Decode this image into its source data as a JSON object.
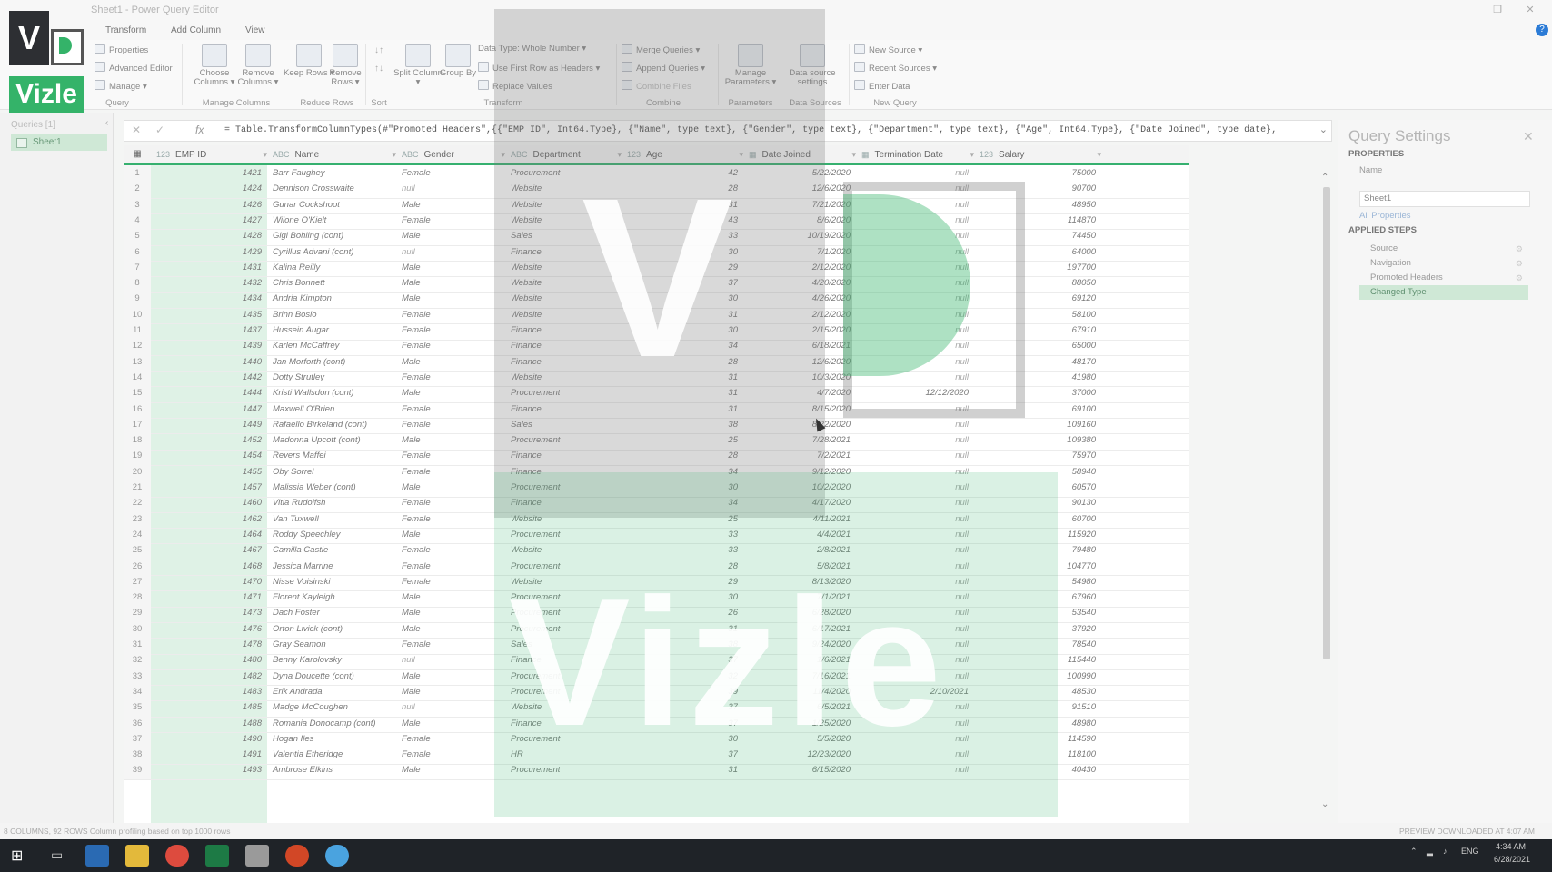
{
  "window": {
    "title": "Sheet1 - Power Query Editor"
  },
  "ribbon_tabs": [
    "Transform",
    "Add Column",
    "View"
  ],
  "ribbon": {
    "properties": "Properties",
    "advanced_editor": "Advanced Editor",
    "manage": "Manage ▾",
    "choose_columns": "Choose Columns ▾",
    "remove_columns": "Remove Columns ▾",
    "keep_rows": "Keep Rows ▾",
    "remove_rows": "Remove Rows ▾",
    "split_column": "Split Column ▾",
    "group_by": "Group By",
    "data_type": "Data Type: Whole Number ▾",
    "first_row_headers": "Use First Row as Headers ▾",
    "replace_values": "Replace Values",
    "merge_queries": "Merge Queries ▾",
    "append_queries": "Append Queries ▾",
    "combine_files": "Combine Files",
    "manage_parameters": "Manage Parameters ▾",
    "data_source_settings": "Data source settings",
    "new_source": "New Source ▾",
    "recent_sources": "Recent Sources ▾",
    "enter_data": "Enter Data",
    "groups": [
      "Query",
      "Manage Columns",
      "Reduce Rows",
      "Sort",
      "Transform",
      "Combine",
      "Parameters",
      "Data Sources",
      "New Query"
    ]
  },
  "left_panel": {
    "title": "Queries [1]",
    "item": "Sheet1"
  },
  "formula": "= Table.TransformColumnTypes(#\"Promoted Headers\",{{\"EMP ID\", Int64.Type}, {\"Name\", type text}, {\"Gender\", type text}, {\"Department\", type text}, {\"Age\", Int64.Type}, {\"Date Joined\", type date},",
  "columns": [
    "EMP ID",
    "Name",
    "Gender",
    "Department",
    "Age",
    "Date Joined",
    "Termination Date",
    "Salary"
  ],
  "column_type_icons": [
    "123",
    "ABC",
    "ABC",
    "ABC",
    "123",
    "▦",
    "▦",
    "123"
  ],
  "rows": [
    [
      "1421",
      "Barr Faughey",
      "Female",
      "Procurement",
      "42",
      "5/22/2020",
      "null",
      "75000"
    ],
    [
      "1424",
      "Dennison Crosswaite",
      "null",
      "Website",
      "28",
      "12/6/2020",
      "null",
      "90700"
    ],
    [
      "1426",
      "Gunar Cockshoot",
      "Male",
      "Website",
      "31",
      "7/21/2020",
      "null",
      "48950"
    ],
    [
      "1427",
      "Wilone O'Kielt",
      "Female",
      "Website",
      "43",
      "8/6/2020",
      "null",
      "114870"
    ],
    [
      "1428",
      "Gigi Bohling (cont)",
      "Male",
      "Sales",
      "33",
      "10/19/2020",
      "null",
      "74450"
    ],
    [
      "1429",
      "Cyrillus Advani (cont)",
      "null",
      "Finance",
      "30",
      "7/1/2020",
      "null",
      "64000"
    ],
    [
      "1431",
      "Kalina Reilly",
      "Male",
      "Website",
      "29",
      "2/12/2020",
      "null",
      "197700"
    ],
    [
      "1432",
      "Chris Bonnett",
      "Male",
      "Website",
      "37",
      "4/20/2020",
      "null",
      "88050"
    ],
    [
      "1434",
      "Andria Kimpton",
      "Male",
      "Website",
      "30",
      "4/26/2020",
      "null",
      "69120"
    ],
    [
      "1435",
      "Brinn Bosio",
      "Female",
      "Website",
      "31",
      "2/12/2020",
      "null",
      "58100"
    ],
    [
      "1437",
      "Hussein Augar",
      "Female",
      "Finance",
      "30",
      "2/15/2020",
      "null",
      "67910"
    ],
    [
      "1439",
      "Karlen McCaffrey",
      "Female",
      "Finance",
      "34",
      "6/18/2021",
      "null",
      "65000"
    ],
    [
      "1440",
      "Jan Morforth (cont)",
      "Male",
      "Finance",
      "28",
      "12/6/2020",
      "null",
      "48170"
    ],
    [
      "1442",
      "Dotty Strutley",
      "Female",
      "Website",
      "31",
      "10/3/2020",
      "null",
      "41980"
    ],
    [
      "1444",
      "Kristi Wallsdon (cont)",
      "Male",
      "Procurement",
      "31",
      "4/7/2020",
      "12/12/2020",
      "37000"
    ],
    [
      "1447",
      "Maxwell O'Brien",
      "Female",
      "Finance",
      "31",
      "8/15/2020",
      "null",
      "69100"
    ],
    [
      "1449",
      "Rafaello Birkeland (cont)",
      "Female",
      "Sales",
      "38",
      "8/22/2020",
      "null",
      "109160"
    ],
    [
      "1452",
      "Madonna Upcott (cont)",
      "Male",
      "Procurement",
      "25",
      "7/28/2021",
      "null",
      "109380"
    ],
    [
      "1454",
      "Revers Maffei",
      "Female",
      "Finance",
      "28",
      "7/2/2021",
      "null",
      "75970"
    ],
    [
      "1455",
      "Oby Sorrel",
      "Female",
      "Finance",
      "34",
      "9/12/2020",
      "null",
      "58940"
    ],
    [
      "1457",
      "Malissia Weber (cont)",
      "Male",
      "Procurement",
      "30",
      "10/2/2020",
      "null",
      "60570"
    ],
    [
      "1460",
      "Vitia Rudolfsh",
      "Female",
      "Finance",
      "34",
      "4/17/2020",
      "null",
      "90130"
    ],
    [
      "1462",
      "Van Tuxwell",
      "Female",
      "Website",
      "25",
      "4/11/2021",
      "null",
      "60700"
    ],
    [
      "1464",
      "Roddy Speechley",
      "Male",
      "Procurement",
      "33",
      "4/4/2021",
      "null",
      "115920"
    ],
    [
      "1467",
      "Camilla Castle",
      "Female",
      "Website",
      "33",
      "2/8/2021",
      "null",
      "79480"
    ],
    [
      "1468",
      "Jessica Marrine",
      "Female",
      "Procurement",
      "28",
      "5/8/2021",
      "null",
      "104770"
    ],
    [
      "1470",
      "Nisse Voisinski",
      "Female",
      "Website",
      "29",
      "8/13/2020",
      "null",
      "54980"
    ],
    [
      "1471",
      "Florent Kayleigh",
      "Male",
      "Procurement",
      "30",
      "7/1/2021",
      "null",
      "67960"
    ],
    [
      "1473",
      "Dach Foster",
      "Male",
      "Procurement",
      "26",
      "6/28/2020",
      "null",
      "53540"
    ],
    [
      "1476",
      "Orton Livick (cont)",
      "Male",
      "Procurement",
      "31",
      "6/17/2021",
      "null",
      "37920"
    ],
    [
      "1478",
      "Gray Seamon",
      "Female",
      "Sales",
      "38",
      "9/24/2020",
      "null",
      "78540"
    ],
    [
      "1480",
      "Benny Karolovsky",
      "null",
      "Finance",
      "37",
      "1/6/2021",
      "null",
      "115440"
    ],
    [
      "1482",
      "Dyna Doucette (cont)",
      "Male",
      "Procurement",
      "32",
      "7/16/2021",
      "null",
      "100990"
    ],
    [
      "1483",
      "Erik Andrada",
      "Male",
      "Procurement",
      "39",
      "11/4/2020",
      "2/10/2021",
      "48530"
    ],
    [
      "1485",
      "Madge McCoughen",
      "null",
      "Website",
      "37",
      "6/5/2021",
      "null",
      "91510"
    ],
    [
      "1488",
      "Romania Donocamp (cont)",
      "Male",
      "Finance",
      "37",
      "1/25/2020",
      "null",
      "48980"
    ],
    [
      "1490",
      "Hogan Iles",
      "Female",
      "Procurement",
      "30",
      "5/5/2020",
      "null",
      "114590"
    ],
    [
      "1491",
      "Valentia Etheridge",
      "Female",
      "HR",
      "37",
      "12/23/2020",
      "null",
      "118100"
    ],
    [
      "1493",
      "Ambrose Elkins",
      "Male",
      "Procurement",
      "31",
      "6/15/2020",
      "null",
      "40430"
    ]
  ],
  "query_settings": {
    "title": "Query Settings",
    "properties_label": "PROPERTIES",
    "name_label": "Name",
    "name_value": "Sheet1",
    "all_properties": "All Properties",
    "applied_steps_label": "APPLIED STEPS",
    "steps": [
      "Source",
      "Navigation",
      "Promoted Headers",
      "Changed Type"
    ]
  },
  "status": {
    "left": "8 COLUMNS, 92 ROWS     Column profiling based on top 1000 rows",
    "right": "PREVIEW DOWNLOADED AT 4:07 AM"
  },
  "taskbar": {
    "time": "4:34 AM",
    "date": "6/28/2021",
    "lang": "ENG"
  },
  "watermark": {
    "letter": "V",
    "word": "Vizle"
  },
  "logo": {
    "letter": "V",
    "word": "Vizle"
  },
  "colors": {
    "accent_green": "#34b369",
    "selection": "#cfe8d6",
    "taskbar": "#1f2328"
  }
}
